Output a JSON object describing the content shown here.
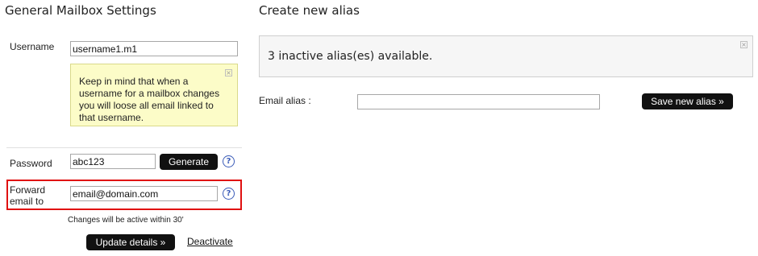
{
  "general": {
    "title": "General Mailbox Settings",
    "username_label": "Username",
    "username_value": "username1.m1",
    "username_note": "Keep in mind that when a username for a mailbox changes you will loose all email linked to that username.",
    "note_close": "×",
    "password_label": "Password",
    "password_value": "abc123",
    "generate_label": "Generate",
    "help_glyph": "?",
    "forward_label": "Forward email to",
    "forward_value": "email@domain.com",
    "changes_note": "Changes will be active within 30'",
    "update_label": "Update details »",
    "deactivate_label": "Deactivate"
  },
  "alias": {
    "title": "Create new alias",
    "info_text": "3 inactive alias(es) available.",
    "info_close": "×",
    "email_alias_label": "Email alias :",
    "email_alias_value": "",
    "save_label": "Save new alias »"
  },
  "icons": {
    "help": "help-circle-icon",
    "close": "close-icon"
  },
  "colors": {
    "highlight_border": "#e01010",
    "note_background": "#fcfcc8",
    "button_background": "#111111",
    "help_icon": "#3a5bb8"
  }
}
